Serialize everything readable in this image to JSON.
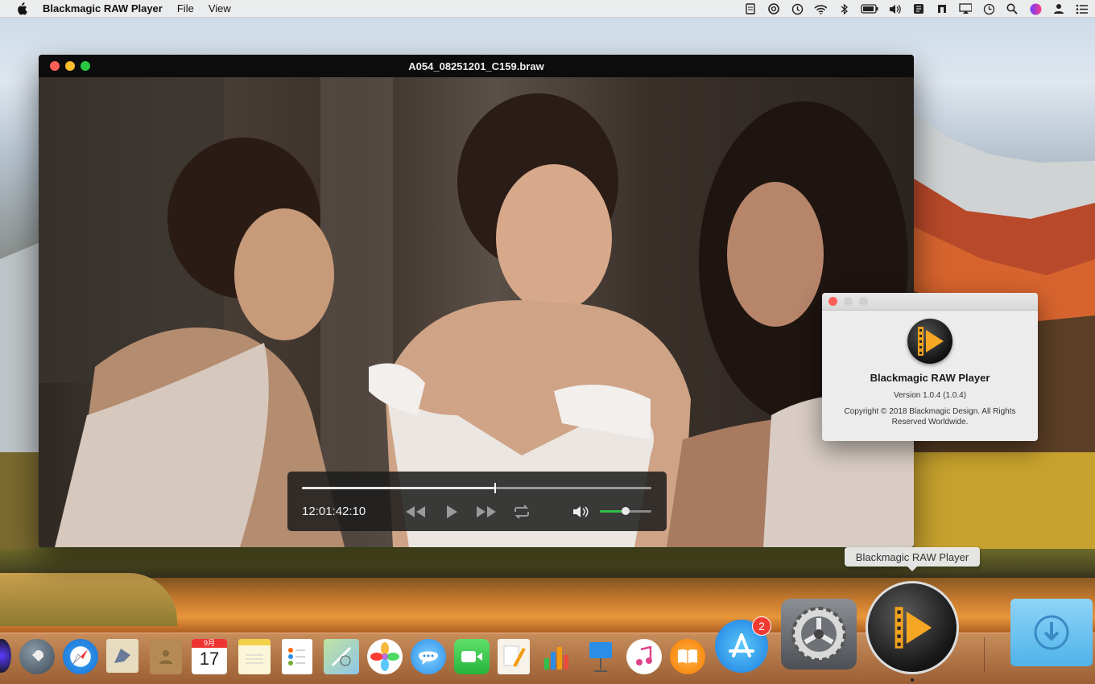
{
  "menubar": {
    "app_name": "Blackmagic RAW Player",
    "menus": [
      "File",
      "View"
    ]
  },
  "status_icons": [
    "clipboard-icon",
    "circle-info-icon",
    "time-machine-icon",
    "wifi-icon",
    "bluetooth-icon",
    "battery-icon",
    "volume-icon",
    "app-status-icon",
    "tile-icon",
    "airplay-icon",
    "clock-icon",
    "spotlight-icon",
    "siri-icon",
    "user-icon",
    "notification-center-icon"
  ],
  "player": {
    "title": "A054_08251201_C159.braw",
    "timecode": "12:01:42:10",
    "progress": 0.55,
    "volume": 0.5
  },
  "about": {
    "name": "Blackmagic RAW Player",
    "version": "Version 1.0.4 (1.0.4)",
    "copyright": "Copyright © 2018 Blackmagic Design. All Rights Reserved Worldwide."
  },
  "tooltip": "Blackmagic RAW Player",
  "dock": {
    "calendar_month": "9月",
    "calendar_day": "17",
    "app_store_badge": "2"
  },
  "colors": {
    "accent_green": "#2fbf4a",
    "close_red": "#fe5f57",
    "minimize_yellow": "#febc2e",
    "zoom_green": "#28c840",
    "badge_red": "#f13a30"
  }
}
